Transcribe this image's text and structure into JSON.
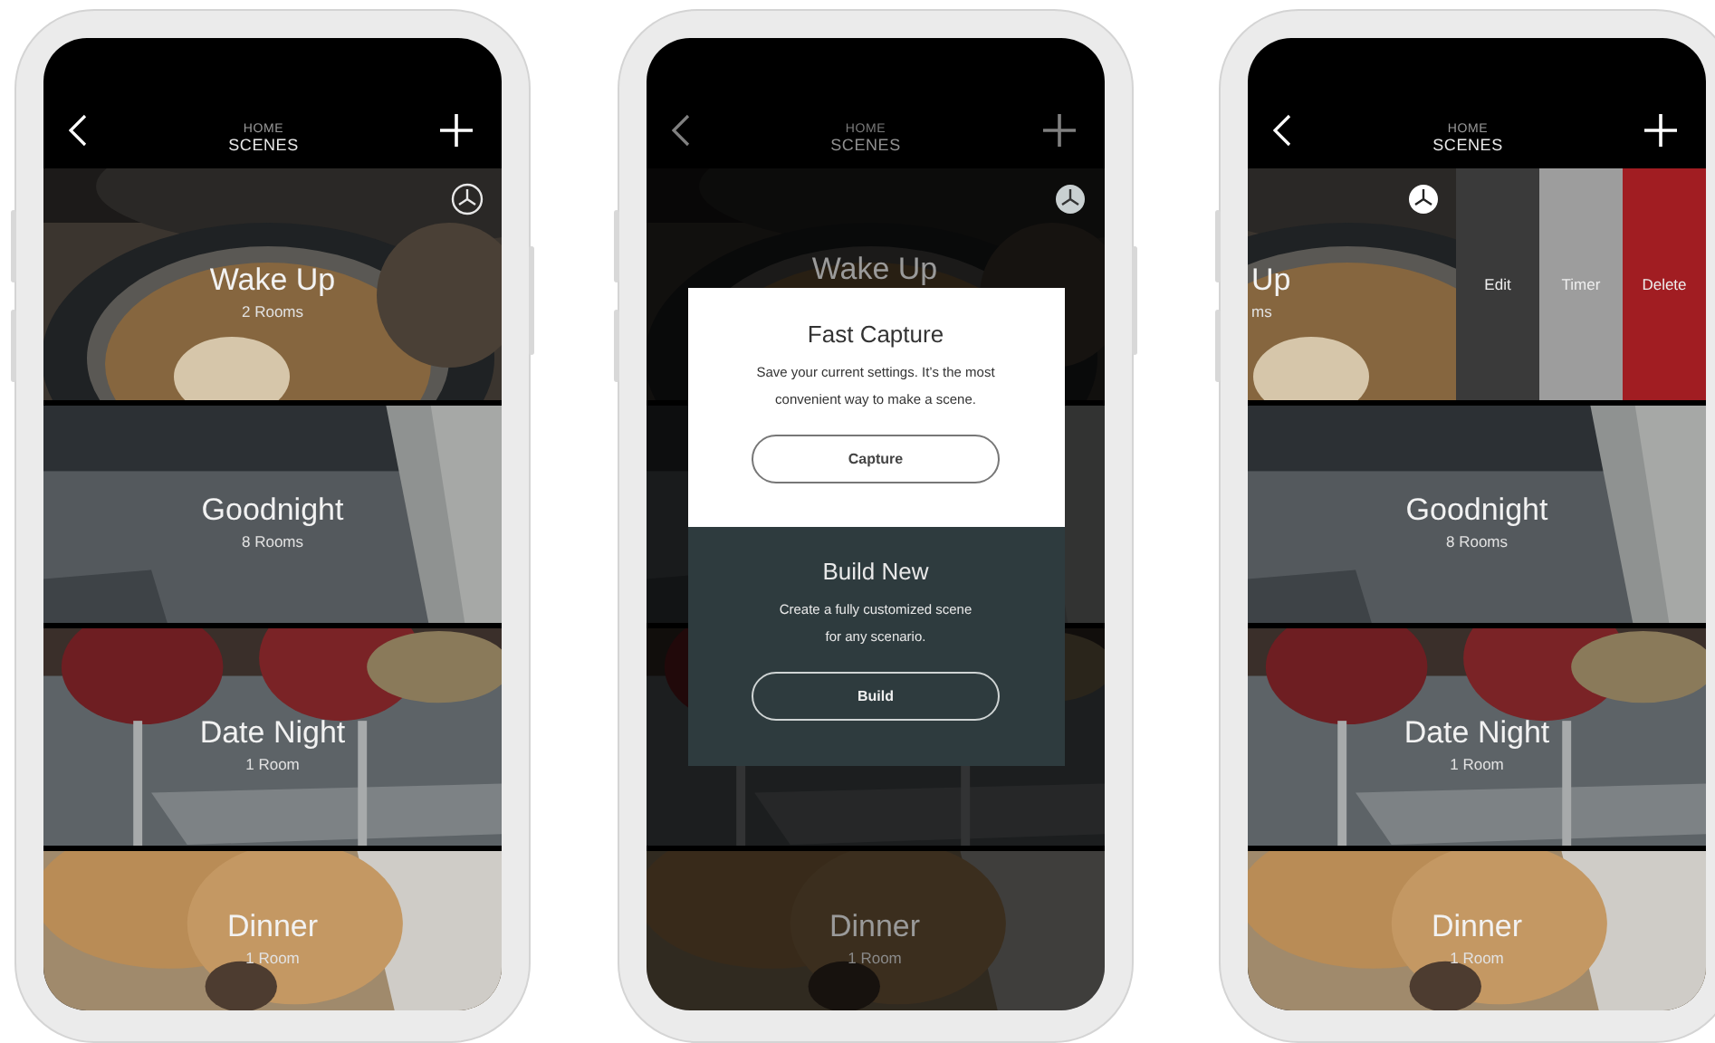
{
  "screens": [
    {
      "dimmed": false,
      "header": {
        "section": "HOME",
        "title": "SCENES"
      },
      "scenes": [
        {
          "name": "Wake Up",
          "rooms": "2 Rooms",
          "timer": true,
          "swiped": false
        },
        {
          "name": "Goodnight",
          "rooms": "8 Rooms",
          "timer": false,
          "swiped": false
        },
        {
          "name": "Date Night",
          "rooms": "1 Room",
          "timer": false,
          "swiped": false
        },
        {
          "name": "Dinner",
          "rooms": "1 Room",
          "timer": false,
          "swiped": false
        }
      ]
    },
    {
      "dimmed": true,
      "header": {
        "section": "HOME",
        "title": "SCENES"
      },
      "scenes": [
        {
          "name": "Wake Up",
          "timer": true,
          "swiped": false
        },
        {
          "timer": false,
          "swiped": false
        },
        {
          "timer": false,
          "swiped": false
        },
        {
          "name": "Dinner",
          "rooms": "1 Room",
          "timer": false,
          "swiped": false
        }
      ],
      "dialog": [
        {
          "kind": "light",
          "title": "Fast Capture",
          "text": "Save your current settings. It’s the most convenient way to make a scene.",
          "button": "Capture"
        },
        {
          "kind": "dark",
          "title": "Build New",
          "text": "Create a fully customized scene for any scenario.",
          "button": "Build"
        }
      ]
    },
    {
      "dimmed": false,
      "header": {
        "section": "HOME",
        "title": "SCENES"
      },
      "scenes": [
        {
          "name": "Up",
          "rooms": "ms",
          "timer": true,
          "swiped": true,
          "actions": [
            {
              "label": "Edit",
              "color": "#3a3a3a"
            },
            {
              "label": "Timer",
              "color": "#9d9d9d"
            },
            {
              "label": "Delete",
              "color": "#a11d22"
            }
          ]
        },
        {
          "name": "Goodnight",
          "rooms": "8 Rooms",
          "timer": false,
          "swiped": false
        },
        {
          "name": "Date Night",
          "rooms": "1 Room",
          "timer": false,
          "swiped": false
        },
        {
          "name": "Dinner",
          "rooms": "1 Room",
          "timer": false,
          "swiped": false
        }
      ]
    }
  ]
}
